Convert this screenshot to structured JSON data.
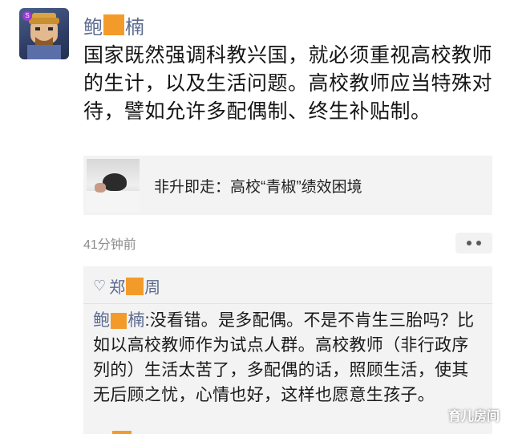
{
  "post": {
    "author_first": "鲍",
    "author_last": "楠",
    "avatar_badge": "S",
    "text": "国家既然强调科教兴国，就必须重视高校教师的生计，以及生活问题。高校教师应当特殊对待，譬如允许多配偶制、终生补贴制。",
    "link_title": "非升即走：高校“青椒”绩效困境",
    "time": "41分钟前"
  },
  "comment": {
    "liker_first": "郑",
    "liker_last": "周",
    "reply_author_first": "鲍",
    "reply_author_last": "楠",
    "reply_text": ":没看错。是多配偶。不是不肯生三胎吗？比如以高校教师作为试点人群。高校教师（非行政序列的）生活太苦了，多配偶的话，照顾生活，使其无后顾之忧，心情也好，这样也愿意生孩子。"
  },
  "watermark": "育儿房间",
  "colors": {
    "name_blue": "#5b6b8f",
    "mask_orange": "#f39b2a",
    "card_bg": "#f3f3f3"
  },
  "icons": {
    "more": "more-dots-icon",
    "like": "heart-icon"
  }
}
